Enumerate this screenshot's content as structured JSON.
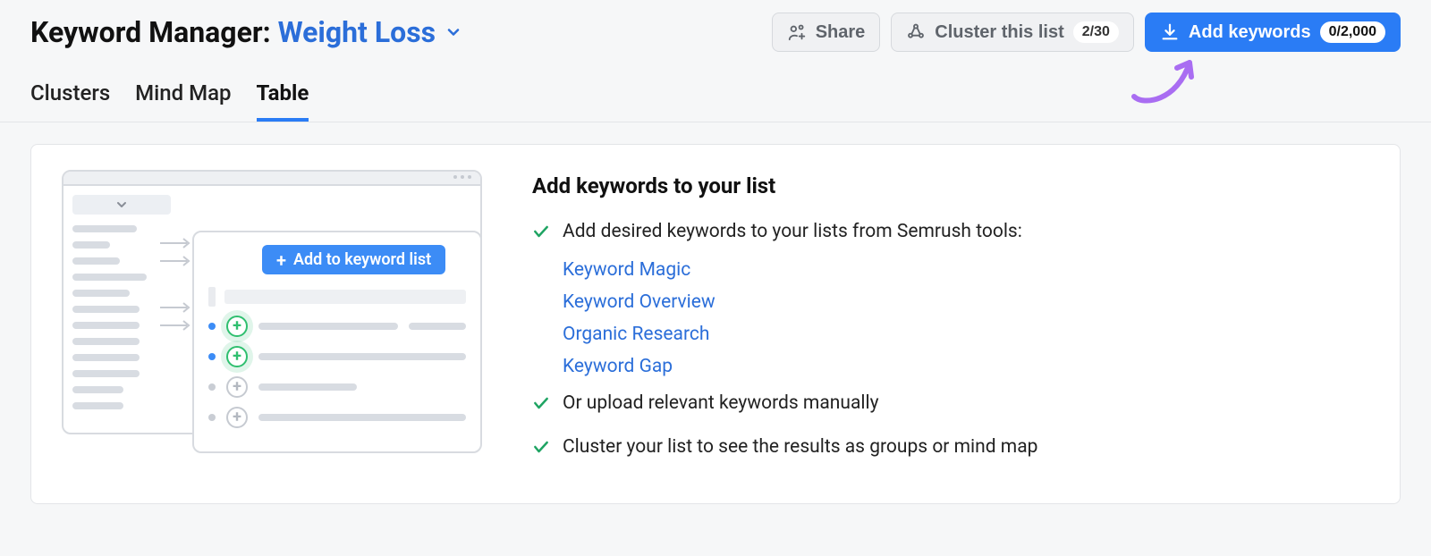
{
  "header": {
    "title_prefix": "Keyword Manager:",
    "list_name": "Weight Loss",
    "share_label": "Share",
    "cluster_label": "Cluster this list",
    "cluster_count": "2/30",
    "add_label": "Add keywords",
    "add_count": "0/2,000"
  },
  "tabs": {
    "clusters": "Clusters",
    "mindmap": "Mind Map",
    "table": "Table",
    "active": "table"
  },
  "content": {
    "illus_button": "Add to keyword list",
    "heading": "Add keywords to your list",
    "bullet1": "Add desired keywords to your lists from Semrush tools:",
    "links": {
      "magic": "Keyword Magic",
      "overview": "Keyword Overview",
      "organic": "Organic Research",
      "gap": "Keyword Gap"
    },
    "bullet2": "Or upload relevant keywords manually",
    "bullet3": "Cluster your list to see the results as groups or mind map"
  }
}
